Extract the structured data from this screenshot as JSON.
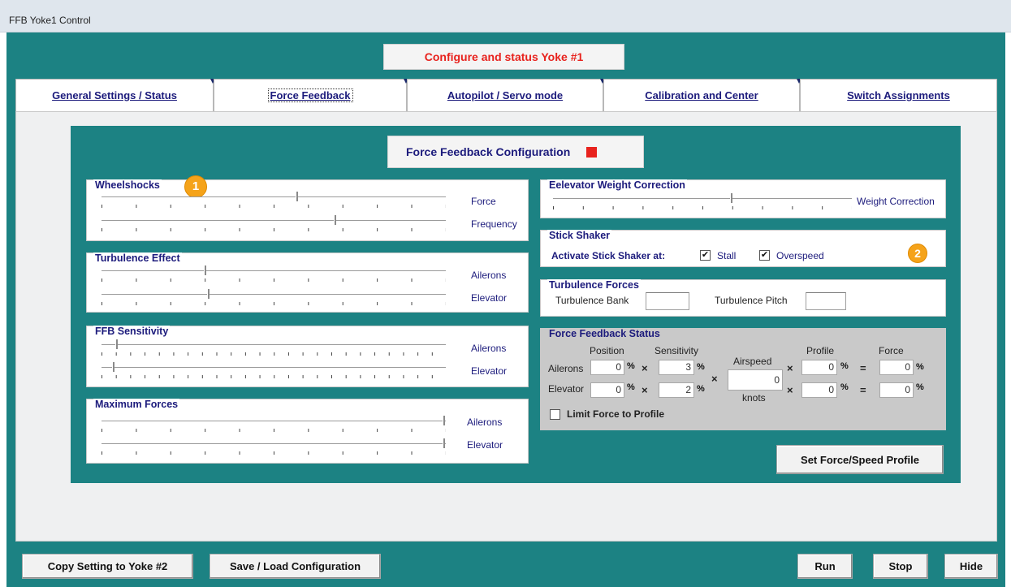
{
  "window": {
    "title": "FFB Yoke1 Control"
  },
  "header": {
    "title": "Configure and status Yoke #1",
    "title_color": "#e8221d"
  },
  "tabs": [
    {
      "label": "General Settings / Status",
      "active": false
    },
    {
      "label": "Force Feedback",
      "active": true
    },
    {
      "label": "Autopilot / Servo mode",
      "active": false
    },
    {
      "label": "Calibration and Center",
      "active": false
    },
    {
      "label": "Switch Assignments",
      "active": false
    }
  ],
  "config": {
    "title": "Force Feedback Configuration",
    "status_color": "#e8221d"
  },
  "wheelshocks": {
    "title": "Wheelshocks",
    "badge": "1",
    "force_label": "Force",
    "force_value": 0.57,
    "freq_label": "Frequency",
    "freq_value": 0.68
  },
  "turbulence_effect": {
    "title": "Turbulence Effect",
    "ailerons_label": "Ailerons",
    "ailerons_value": 0.3,
    "elevator_label": "Elevator",
    "elevator_value": 0.31
  },
  "ffb_sensitivity": {
    "title": "FFB Sensitivity",
    "ailerons_label": "Ailerons",
    "ailerons_value": 0.04,
    "elevator_label": "Elevator",
    "elevator_value": 0.03
  },
  "maximum_forces": {
    "title": "Maximum Forces",
    "ailerons_label": "Ailerons",
    "ailerons_value": 1.0,
    "elevator_label": "Elevator",
    "elevator_value": 1.0
  },
  "elevator_weight": {
    "title": "Eelevator Weight Correction",
    "label": "Weight Correction",
    "value": 0.6
  },
  "stick_shaker": {
    "title": "Stick Shaker",
    "activate_label": "Activate Stick Shaker at:",
    "stall_label": "Stall",
    "stall_checked": true,
    "overspeed_label": "Overspeed",
    "overspeed_checked": true,
    "badge": "2"
  },
  "turbulence_forces": {
    "title": "Turbulence Forces",
    "bank_label": "Turbulence Bank",
    "pitch_label": "Turbulence Pitch"
  },
  "ffb_status": {
    "title": "Force Feedback Status",
    "position_header": "Position",
    "sensitivity_header": "Sensitivity",
    "airspeed_header": "Airspeed",
    "profile_header": "Profile",
    "force_header": "Force",
    "airspeed_unit": "knots",
    "airspeed_value": "0",
    "ailerons": {
      "label": "Ailerons",
      "position": "0",
      "sensitivity": "3",
      "profile": "0",
      "force": "0"
    },
    "elevator": {
      "label": "Elevator",
      "position": "0",
      "sensitivity": "2",
      "profile": "0",
      "force": "0"
    },
    "pct": "%",
    "times": "×",
    "equals": "=",
    "limit_label": "Limit Force to Profile",
    "limit_checked": false
  },
  "buttons": {
    "set_profile": "Set Force/Speed  Profile",
    "copy": "Copy Setting to Yoke #2",
    "save_load": "Save / Load  Configuration",
    "run": "Run",
    "stop": "Stop",
    "hide": "Hide"
  }
}
